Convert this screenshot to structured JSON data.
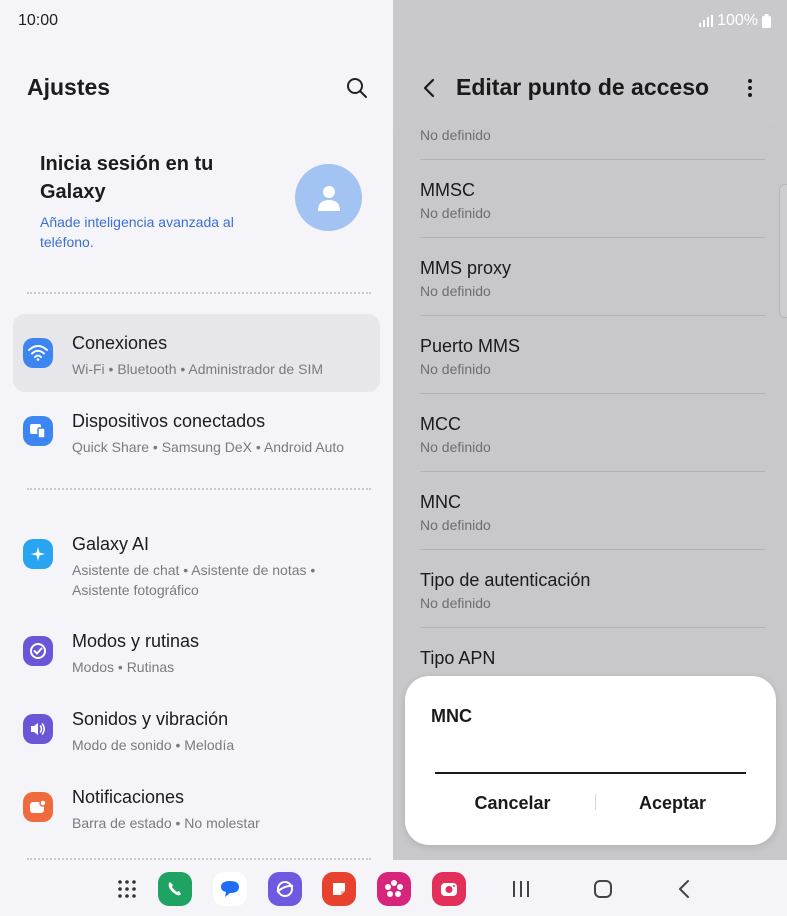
{
  "status": {
    "time": "10:00",
    "battery": "100%"
  },
  "left": {
    "title": "Ajustes",
    "account": {
      "title": "Inicia sesión en tu Galaxy",
      "subtitle": "Añade inteligencia avanzada al teléfono."
    },
    "items": [
      {
        "title": "Conexiones",
        "subtitle": "Wi-Fi • Bluetooth • Administrador de SIM",
        "icon": "wifi-icon",
        "color": "#3d86f2"
      },
      {
        "title": "Dispositivos conectados",
        "subtitle": "Quick Share • Samsung DeX • Android Auto",
        "icon": "devices-icon",
        "color": "#3d86f2"
      },
      {
        "title": "Galaxy AI",
        "subtitle": "Asistente de chat • Asistente de notas • Asistente fotográfico",
        "icon": "sparkle-icon",
        "color": "#29a4f0"
      },
      {
        "title": "Modos y rutinas",
        "subtitle": "Modos • Rutinas",
        "icon": "check-circle-icon",
        "color": "#6a57d8"
      },
      {
        "title": "Sonidos y vibración",
        "subtitle": "Modo de sonido • Melodía",
        "icon": "speaker-icon",
        "color": "#6a57d8"
      },
      {
        "title": "Notificaciones",
        "subtitle": "Barra de estado • No molestar",
        "icon": "notification-icon",
        "color": "#ef6a3c"
      }
    ]
  },
  "right": {
    "title": "Editar punto de acceso",
    "rows": [
      {
        "label": "",
        "value": "No definido"
      },
      {
        "label": "MMSC",
        "value": "No definido"
      },
      {
        "label": "MMS proxy",
        "value": "No definido"
      },
      {
        "label": "Puerto MMS",
        "value": "No definido"
      },
      {
        "label": "MCC",
        "value": "No definido"
      },
      {
        "label": "MNC",
        "value": "No definido"
      },
      {
        "label": "Tipo de autenticación",
        "value": "No definido"
      },
      {
        "label": "Tipo APN",
        "value": ""
      }
    ]
  },
  "dialog": {
    "title": "MNC",
    "input_value": "",
    "cancel": "Cancelar",
    "accept": "Aceptar"
  },
  "dock": [
    {
      "name": "phone-app-icon",
      "color": "#1ea362"
    },
    {
      "name": "messages-app-icon",
      "color": "#ffffff"
    },
    {
      "name": "internet-app-icon",
      "color": "#6d5ae0"
    },
    {
      "name": "notes-app-icon",
      "color": "#e8422f"
    },
    {
      "name": "gallery-app-icon",
      "color": "#d6257a"
    },
    {
      "name": "camera-app-icon",
      "color": "#e3305a"
    }
  ]
}
